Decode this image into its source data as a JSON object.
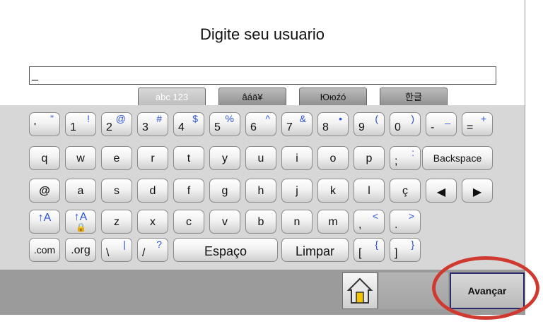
{
  "title": "Digite seu usuario",
  "input": {
    "value": "_"
  },
  "tabs": [
    "abc 123",
    "âáä¥",
    "Ююźó",
    "한글"
  ],
  "keys_row1": [
    {
      "lo": "'",
      "hi": "\""
    },
    {
      "lo": "1",
      "hi": "!"
    },
    {
      "lo": "2",
      "hi": "@"
    },
    {
      "lo": "3",
      "hi": "#"
    },
    {
      "lo": "4",
      "hi": "$"
    },
    {
      "lo": "5",
      "hi": "%"
    },
    {
      "lo": "6",
      "hi": "^"
    },
    {
      "lo": "7",
      "hi": "&"
    },
    {
      "lo": "8",
      "hi": "•"
    },
    {
      "lo": "9",
      "hi": "("
    },
    {
      "lo": "0",
      "hi": ")"
    },
    {
      "lo": "-",
      "hi": "_"
    },
    {
      "lo": "=",
      "hi": "+"
    }
  ],
  "keys_row2": [
    "q",
    "w",
    "e",
    "r",
    "t",
    "y",
    "u",
    "i",
    "o",
    "p"
  ],
  "key_semicolon": {
    "lo": ";",
    "hi": ":"
  },
  "backspace": "Backspace",
  "keys_row3": [
    "@",
    "a",
    "s",
    "d",
    "f",
    "g",
    "h",
    "j",
    "k",
    "l",
    "ç"
  ],
  "arrows": {
    "left": "◀",
    "right": "▶"
  },
  "shift": "↑A",
  "capslock": "↑A",
  "lock_glyph": "🔒",
  "keys_row4": [
    "z",
    "x",
    "c",
    "v",
    "b",
    "n",
    "m"
  ],
  "key_comma": {
    "lo": ",",
    "hi": "<"
  },
  "key_period": {
    "lo": ".",
    "hi": ">"
  },
  "key_com": ".com",
  "key_org": ".org",
  "key_backslash": {
    "lo": "\\",
    "hi": "|"
  },
  "key_slash": {
    "lo": "/",
    "hi": "?"
  },
  "space": "Espaço",
  "clear": "Limpar",
  "key_lbracket": {
    "lo": "[",
    "hi": "{"
  },
  "key_rbracket": {
    "lo": "]",
    "hi": "}"
  },
  "next_button": "Avançar",
  "colors": {
    "accent": "#2d52d8",
    "annotation": "#d0392f"
  }
}
